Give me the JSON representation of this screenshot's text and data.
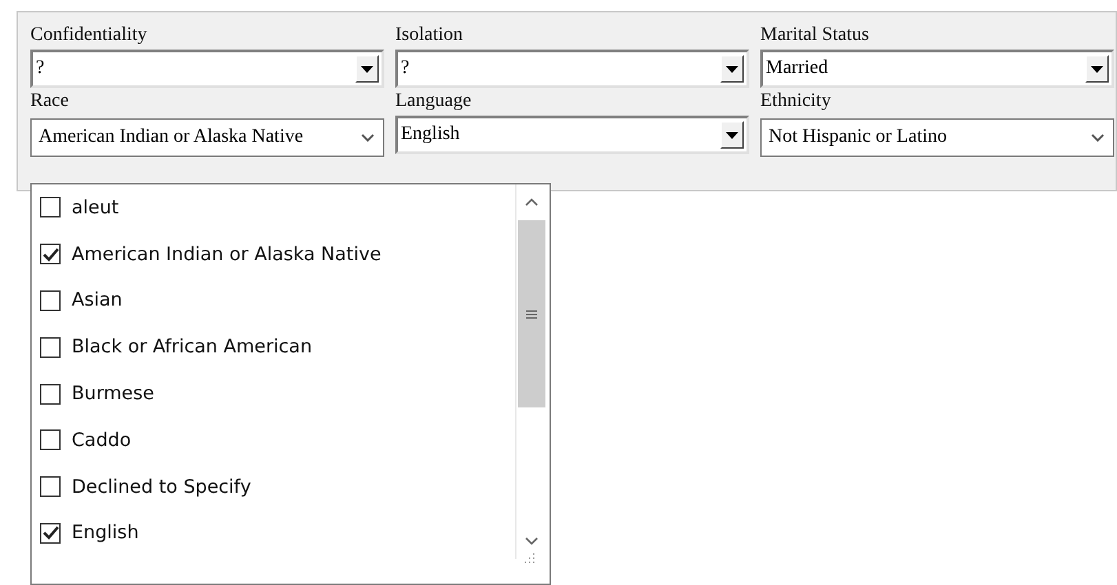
{
  "fields": [
    {
      "label": "Confidentiality",
      "value": "?",
      "kind": "classic"
    },
    {
      "label": "Isolation",
      "value": "?",
      "kind": "classic"
    },
    {
      "label": "Marital Status",
      "value": "Married",
      "kind": "classic"
    },
    {
      "label": "Race",
      "value": "American Indian or Alaska Native",
      "kind": "modern"
    },
    {
      "label": "Language",
      "value": "English",
      "kind": "classic"
    },
    {
      "label": "Ethnicity",
      "value": "Not Hispanic or Latino",
      "kind": "modern"
    }
  ],
  "race_dropdown": {
    "options": [
      {
        "label": "aleut",
        "checked": false
      },
      {
        "label": "American Indian or Alaska Native",
        "checked": true
      },
      {
        "label": "Asian",
        "checked": false
      },
      {
        "label": "Black or African American",
        "checked": false
      },
      {
        "label": "Burmese",
        "checked": false
      },
      {
        "label": "Caddo",
        "checked": false
      },
      {
        "label": "Declined to Specify",
        "checked": false
      },
      {
        "label": "English",
        "checked": true
      }
    ]
  }
}
